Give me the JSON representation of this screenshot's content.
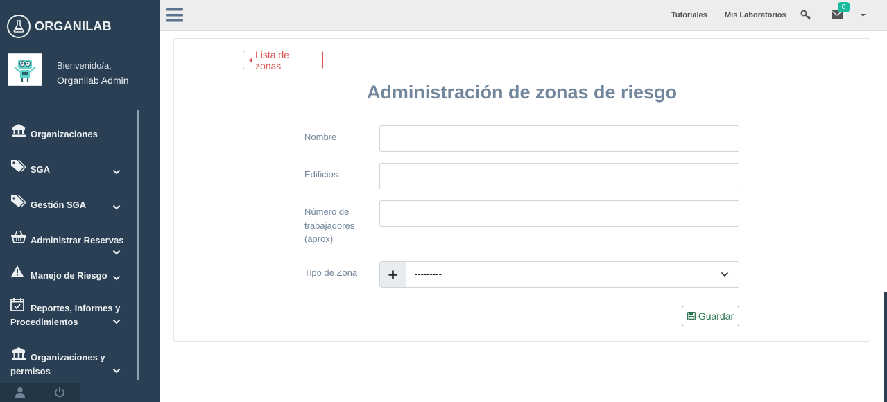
{
  "app": {
    "brand": "ORGANILAB"
  },
  "profile": {
    "welcome": "Bienvenido/a,",
    "username": "Organilab Admin"
  },
  "sidebar": {
    "items": [
      {
        "label": "Organizaciones",
        "icon": "institution-icon",
        "has_chevron": false
      },
      {
        "label": "SGA",
        "icon": "tags-icon",
        "has_chevron": true
      },
      {
        "label": "Gestión SGA",
        "icon": "tags-icon",
        "has_chevron": true
      },
      {
        "label": "Administrar Reservas",
        "icon": "basket-icon",
        "has_chevron": true
      },
      {
        "label": "Manejo de Riesgo",
        "icon": "warning-icon",
        "has_chevron": true
      },
      {
        "label": "Reportes, Informes y Procedimientos",
        "icon": "calendar-check-icon",
        "has_chevron": true
      },
      {
        "label": "Organizaciones y permisos",
        "icon": "institution-icon",
        "has_chevron": true
      }
    ],
    "footer": [
      "user-icon",
      "power-icon"
    ]
  },
  "topnav": {
    "tutorials": "Tutoriales",
    "my_labs": "Mis Laboratorios",
    "messages_count": "0"
  },
  "main": {
    "back_label": "Lista de zonas",
    "title": "Administración de zonas de riesgo",
    "fields": {
      "name_label": "Nombre",
      "buildings_label": "Edificios",
      "workers_label": "Número de trabajadores (aprox)",
      "zone_type_label": "Tipo de Zona",
      "zone_type_value": "---------"
    },
    "save_label": "Guardar"
  },
  "colors": {
    "sidebar": "#2a3f54",
    "danger": "#d9534f",
    "success": "#26734d",
    "title": "#73879c",
    "badge": "#1abb9c"
  }
}
